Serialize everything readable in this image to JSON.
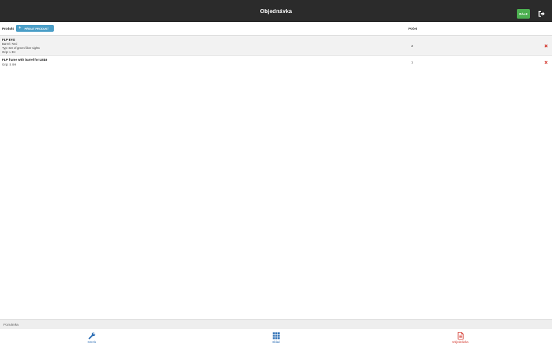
{
  "header": {
    "title": "Objednávka",
    "next_label": "DÁLE",
    "logout_icon": "logout-icon"
  },
  "table": {
    "col_product": "Produkt",
    "add_button": "PŘIDAT PRODUKT",
    "col_count": "Počet"
  },
  "rows": [
    {
      "name": "FLP EVO",
      "lines": [
        "Barrel: Red",
        "Typ: Set of green fiber sights",
        "Grip: L 8H"
      ],
      "qty": "3"
    },
    {
      "name": "FLP frame with barrel for LB16",
      "lines": [
        "Grip: S 8H"
      ],
      "qty": "1"
    }
  ],
  "note": {
    "label": "Poznámka"
  },
  "tabs": [
    {
      "label": "Servis",
      "icon": "wrench-icon"
    },
    {
      "label": "Sklad",
      "icon": "grid-icon"
    },
    {
      "label": "Objednávka",
      "icon": "document-icon",
      "active": true
    }
  ],
  "colors": {
    "header_bg": "#2b2b2b",
    "next_btn": "#4caf50",
    "add_btn": "#4a9ec7",
    "delete": "#d43a30",
    "tab_blue": "#2e6fb5",
    "tab_active": "#d43a30"
  }
}
